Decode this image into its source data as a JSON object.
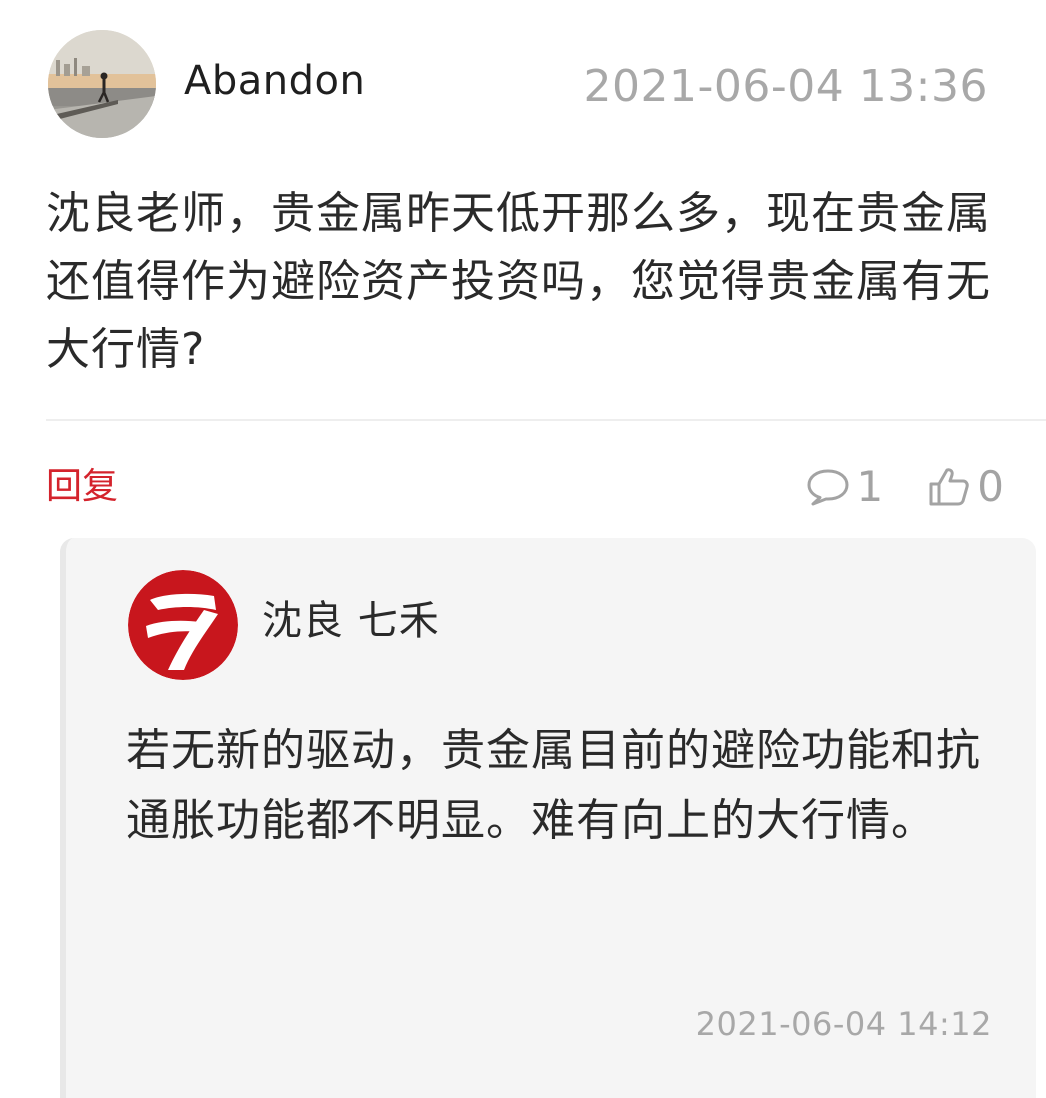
{
  "comment": {
    "username": "Abandon",
    "avatar_icon": "avatar-photo-person-on-pier-sunset",
    "timestamp": "2021-06-04 13:36",
    "text": "沈良老师，贵金属昨天低开那么多，现在贵金属还值得作为避险资产投资吗，您觉得贵金属有无大行情?"
  },
  "actions": {
    "reply_label": "回复",
    "comment_icon": "speech-bubble-icon",
    "comment_count": "1",
    "like_icon": "thumbs-up-icon",
    "like_count": "0"
  },
  "reply": {
    "author": "沈良 七禾",
    "avatar_icon": "red-seven-logo",
    "text": "若无新的驱动，贵金属目前的避险功能和抗通胀功能都不明显。难有向上的大行情。",
    "timestamp": "2021-06-04 14:12"
  },
  "colors": {
    "accent_red": "#d4232c",
    "muted_gray": "#a8a8a8",
    "card_background": "#f5f5f5"
  }
}
